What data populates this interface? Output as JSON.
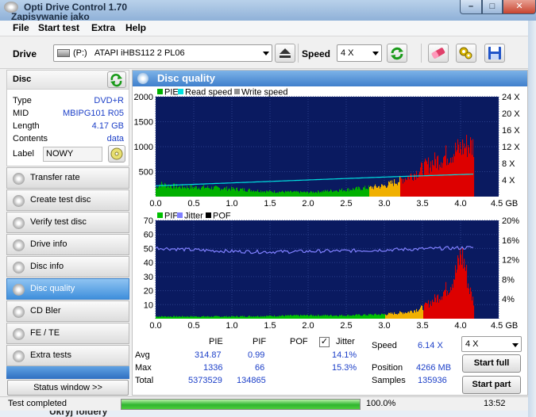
{
  "window": {
    "title": "Opti Drive Control 1.70",
    "subtitle": "Zapisywanie jako",
    "min": "–",
    "max": "□",
    "close": "✕"
  },
  "menu": [
    "File",
    "Start test",
    "Extra",
    "Help"
  ],
  "drive": {
    "label": "Drive",
    "letter": "(P:)",
    "name": "ATAPI iHBS112  2 PL06",
    "speed_label": "Speed",
    "speed_value": "4 X"
  },
  "disc": {
    "header": "Disc",
    "rows": [
      {
        "k": "Type",
        "v": "DVD+R"
      },
      {
        "k": "MID",
        "v": "MBIPG101 R05"
      },
      {
        "k": "Length",
        "v": "4.17 GB"
      },
      {
        "k": "Contents",
        "v": "data"
      }
    ],
    "label_key": "Label",
    "label_value": "NOWY"
  },
  "nav": [
    "Transfer rate",
    "Create test disc",
    "Verify test disc",
    "Drive info",
    "Disc info",
    "Disc quality",
    "CD Bler",
    "FE / TE",
    "Extra tests"
  ],
  "nav_active": "Disc quality",
  "status_window_button": "Status window >>",
  "panel": {
    "title": "Disc quality"
  },
  "colors": {
    "pie": "#00b000",
    "read": "#00e0e0",
    "write": "#909090",
    "pif": "#00c000",
    "jitter": "#8080ff",
    "pof": "#000000",
    "high": "#dd0000",
    "mid": "#f0b000",
    "plot_bg": "#0a1a60"
  },
  "chart_data": [
    {
      "type": "bar",
      "legend": [
        "PIE",
        "Read speed",
        "Write speed"
      ],
      "x_ticks": [
        "0.0",
        "0.5",
        "1.0",
        "1.5",
        "2.0",
        "2.5",
        "3.0",
        "3.5",
        "4.0",
        "4.5 GB"
      ],
      "xlim": [
        0,
        4.5
      ],
      "y_left_ticks": [
        "2000",
        "1500",
        "1000",
        "500"
      ],
      "ylim_left": [
        0,
        2000
      ],
      "y_right_ticks": [
        "24 X",
        "20 X",
        "16 X",
        "12 X",
        "8 X",
        "4 X"
      ],
      "ylim_right": [
        0,
        24
      ],
      "pie_envelope": [
        [
          0.0,
          230
        ],
        [
          0.05,
          320
        ],
        [
          0.3,
          250
        ],
        [
          0.6,
          240
        ],
        [
          1.0,
          200
        ],
        [
          1.5,
          130
        ],
        [
          2.0,
          110
        ],
        [
          2.5,
          180
        ],
        [
          2.8,
          230
        ],
        [
          3.0,
          280
        ],
        [
          3.2,
          420
        ],
        [
          3.4,
          600
        ],
        [
          3.6,
          850
        ],
        [
          3.8,
          1050
        ],
        [
          4.0,
          1250
        ],
        [
          4.1,
          1340
        ],
        [
          4.15,
          1300
        ],
        [
          4.17,
          1336
        ]
      ],
      "read_speed": [
        [
          0.0,
          2.6
        ],
        [
          1.0,
          3.3
        ],
        [
          2.0,
          4.0
        ],
        [
          3.0,
          4.7
        ],
        [
          4.17,
          5.4
        ]
      ]
    },
    {
      "type": "bar",
      "legend": [
        "PIF",
        "Jitter",
        "POF"
      ],
      "x_ticks": [
        "0.0",
        "0.5",
        "1.0",
        "1.5",
        "2.0",
        "2.5",
        "3.0",
        "3.5",
        "4.0",
        "4.5 GB"
      ],
      "xlim": [
        0,
        4.5
      ],
      "y_left_ticks": [
        "70",
        "60",
        "50",
        "40",
        "30",
        "20",
        "10"
      ],
      "ylim_left": [
        0,
        70
      ],
      "y_right_ticks": [
        "20%",
        "16%",
        "12%",
        "8%",
        "4%"
      ],
      "ylim_right": [
        0,
        20
      ],
      "pif_envelope": [
        [
          0.0,
          2
        ],
        [
          1.0,
          2
        ],
        [
          2.0,
          3
        ],
        [
          2.5,
          3
        ],
        [
          3.0,
          4
        ],
        [
          3.3,
          6
        ],
        [
          3.5,
          10
        ],
        [
          3.7,
          20
        ],
        [
          3.85,
          30
        ],
        [
          3.95,
          45
        ],
        [
          4.0,
          60
        ],
        [
          4.05,
          50
        ],
        [
          4.1,
          30
        ],
        [
          4.17,
          15
        ]
      ],
      "jitter": [
        [
          0.0,
          14.4
        ],
        [
          0.5,
          14.0
        ],
        [
          1.0,
          13.7
        ],
        [
          1.5,
          13.6
        ],
        [
          2.0,
          13.7
        ],
        [
          2.5,
          13.8
        ],
        [
          3.0,
          14.0
        ],
        [
          3.5,
          14.2
        ],
        [
          4.0,
          14.4
        ],
        [
          4.17,
          14.5
        ]
      ]
    }
  ],
  "stats": {
    "col_pie": "PIE",
    "col_pif": "PIF",
    "col_pof": "POF",
    "col_jitter": "Jitter",
    "avg_label": "Avg",
    "max_label": "Max",
    "total_label": "Total",
    "avg": {
      "pie": "314.87",
      "pif": "0.99",
      "jitter": "14.1%"
    },
    "max": {
      "pie": "1336",
      "pif": "66",
      "jitter": "15.3%"
    },
    "total": {
      "pie": "5373529",
      "pif": "134865"
    }
  },
  "right": {
    "speed_label": "Speed",
    "speed_value": "6.14 X",
    "speed_select": "4 X",
    "position_label": "Position",
    "position_value": "4266 MB",
    "samples_label": "Samples",
    "samples_value": "135936",
    "start_full": "Start full",
    "start_part": "Start part"
  },
  "statusbar": {
    "text": "Test completed",
    "progress": 1.0,
    "percent": "100.0%",
    "time": "13:52"
  },
  "taskbar_peek": "Ukryj foldery"
}
